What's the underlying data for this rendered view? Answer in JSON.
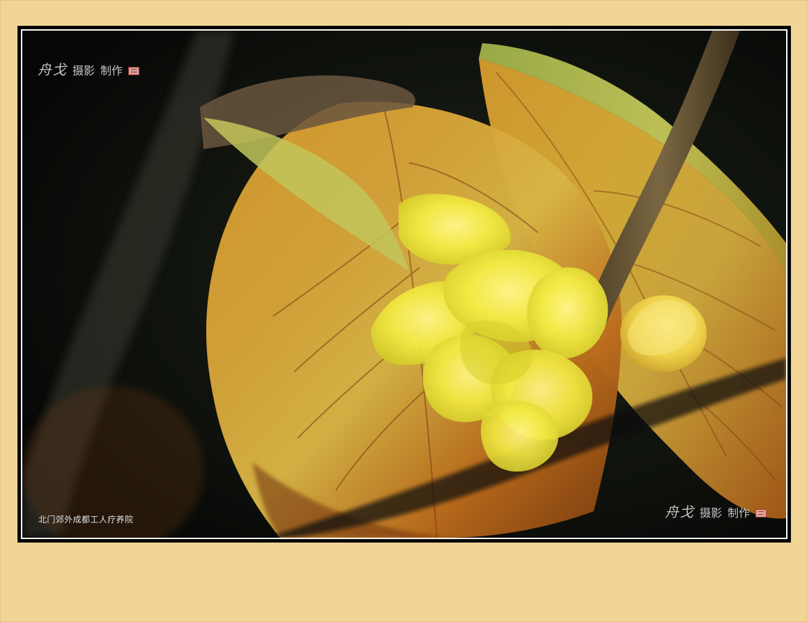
{
  "mat": {
    "background_color": "#f2d596"
  },
  "photo": {
    "caption": "北门郊外成都工人疗养院",
    "watermark_top": {
      "name": "舟戈",
      "label1": "摄影",
      "label2": "制作"
    },
    "watermark_bottom": {
      "name": "舟戈",
      "label1": "摄影",
      "label2": "制作"
    }
  },
  "palette": {
    "dark_bg": "#0b0f0a",
    "leaf_amber": "#b8741f",
    "flower_yellow": "#f2e436",
    "bud_yellow": "#f0d54a",
    "seal_red": "#b7322f"
  },
  "icons": {
    "seal": "red-seal-stamp"
  }
}
